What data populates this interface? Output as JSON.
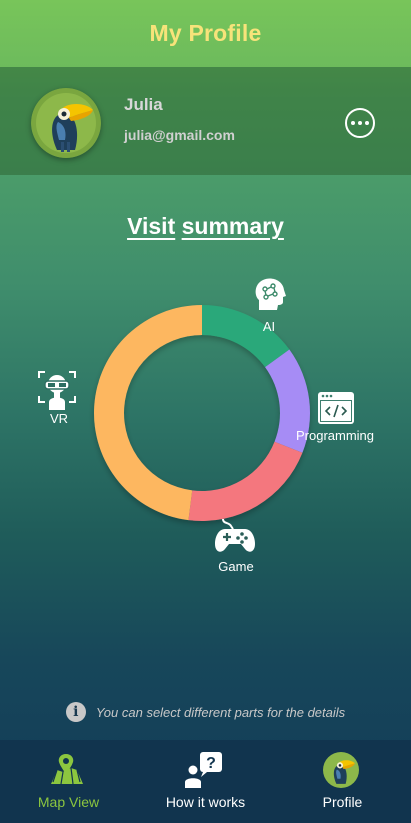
{
  "header": {
    "title": "My Profile"
  },
  "profile": {
    "name": "Julia",
    "email": "julia@gmail.com",
    "avatar_icon": "toucan-avatar-icon",
    "more_icon": "more-horizontal-icon"
  },
  "summary": {
    "title_part1": "Visit",
    "title_part2": "summary"
  },
  "chart_data": {
    "type": "pie",
    "donut": true,
    "title": "Visit summary",
    "categories": [
      "AI",
      "Programming",
      "Game",
      "VR"
    ],
    "values": [
      15,
      16,
      21,
      48
    ],
    "colors": [
      "#2aa87a",
      "#a68cf5",
      "#f4777e",
      "#fdb761"
    ],
    "legend": "labels-with-icons-around"
  },
  "categories": {
    "ai": {
      "label": "AI",
      "icon": "brain-head-icon"
    },
    "programming": {
      "label": "Programming",
      "icon": "code-window-icon"
    },
    "game": {
      "label": "Game",
      "icon": "gamepad-icon"
    },
    "vr": {
      "label": "VR",
      "icon": "vr-headset-icon"
    }
  },
  "info": {
    "text": "You can select different parts for the details",
    "icon": "info-icon"
  },
  "nav": {
    "items": [
      {
        "label": "Map View",
        "icon": "map-pin-icon",
        "active": true
      },
      {
        "label": "How it works",
        "icon": "question-person-icon",
        "active": false
      },
      {
        "label": "Profile",
        "icon": "toucan-avatar-icon",
        "active": false
      }
    ]
  }
}
